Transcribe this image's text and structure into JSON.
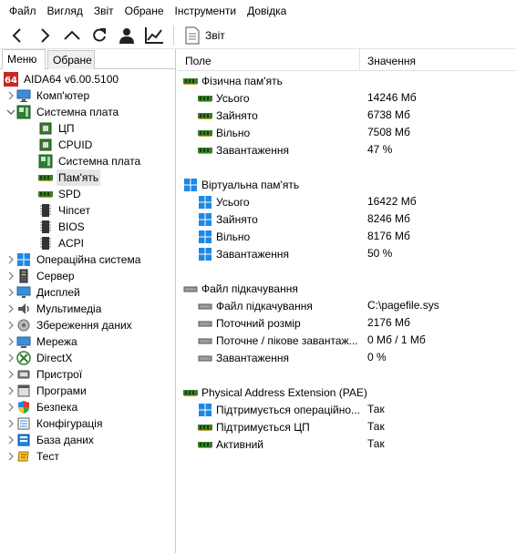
{
  "menu": [
    "Файл",
    "Вигляд",
    "Звіт",
    "Обране",
    "Інструменти",
    "Довідка"
  ],
  "toolbar": {
    "report_label": "Звіт"
  },
  "tabs": {
    "menu": "Меню",
    "favorites": "Обране"
  },
  "tree": {
    "root": "AIDA64 v6.00.5100",
    "items": [
      {
        "label": "Комп'ютер",
        "icon": "computer-icon"
      },
      {
        "label": "Системна плата",
        "icon": "motherboard-icon"
      },
      {
        "label": "ЦП",
        "icon": "cpu-icon"
      },
      {
        "label": "CPUID",
        "icon": "cpuid-icon"
      },
      {
        "label": "Системна плата",
        "icon": "motherboard-icon"
      },
      {
        "label": "Пам'ять",
        "icon": "ram-icon"
      },
      {
        "label": "SPD",
        "icon": "ram-icon"
      },
      {
        "label": "Чіпсет",
        "icon": "chip-icon"
      },
      {
        "label": "BIOS",
        "icon": "chip-icon"
      },
      {
        "label": "ACPI",
        "icon": "chip-icon"
      },
      {
        "label": "Операційна система",
        "icon": "windows-icon"
      },
      {
        "label": "Сервер",
        "icon": "server-icon"
      },
      {
        "label": "Дисплей",
        "icon": "monitor-icon"
      },
      {
        "label": "Мультимедіа",
        "icon": "multimedia-icon"
      },
      {
        "label": "Збереження даних",
        "icon": "storage-icon"
      },
      {
        "label": "Мережа",
        "icon": "network-icon"
      },
      {
        "label": "DirectX",
        "icon": "directx-icon"
      },
      {
        "label": "Пристрої",
        "icon": "devices-icon"
      },
      {
        "label": "Програми",
        "icon": "programs-icon"
      },
      {
        "label": "Безпека",
        "icon": "security-icon"
      },
      {
        "label": "Конфігурація",
        "icon": "config-icon"
      },
      {
        "label": "База даних",
        "icon": "database-icon"
      },
      {
        "label": "Тест",
        "icon": "test-icon"
      }
    ]
  },
  "columns": {
    "field": "Поле",
    "value": "Значення"
  },
  "sections": {
    "physical": {
      "title": "Фізична пам'ять",
      "rows": [
        {
          "field": "Усього",
          "value": "14246 Мб"
        },
        {
          "field": "Зайнято",
          "value": "6738 Мб"
        },
        {
          "field": "Вільно",
          "value": "7508 Мб"
        },
        {
          "field": "Завантаження",
          "value": "47 %"
        }
      ]
    },
    "virtual": {
      "title": "Віртуальна пам'ять",
      "rows": [
        {
          "field": "Усього",
          "value": "16422 Мб"
        },
        {
          "field": "Зайнято",
          "value": "8246 Мб"
        },
        {
          "field": "Вільно",
          "value": "8176 Мб"
        },
        {
          "field": "Завантаження",
          "value": "50 %"
        }
      ]
    },
    "pagefile": {
      "title": "Файл підкачування",
      "rows": [
        {
          "field": "Файл підкачування",
          "value": "C:\\pagefile.sys"
        },
        {
          "field": "Поточний розмір",
          "value": "2176 Мб"
        },
        {
          "field": "Поточне / пікове завантаж...",
          "value": "0 Мб / 1 Мб"
        },
        {
          "field": "Завантаження",
          "value": "0 %"
        }
      ]
    },
    "pae": {
      "title": "Physical Address Extension (PAE)",
      "rows": [
        {
          "field": "Підтримується операційно...",
          "value": "Так"
        },
        {
          "field": "Підтримується ЦП",
          "value": "Так"
        },
        {
          "field": "Активний",
          "value": "Так"
        }
      ]
    }
  },
  "colors": {
    "accent": "#1e88e5",
    "ram_green": "#3a7d2c",
    "selection": "#e5e5e5"
  }
}
